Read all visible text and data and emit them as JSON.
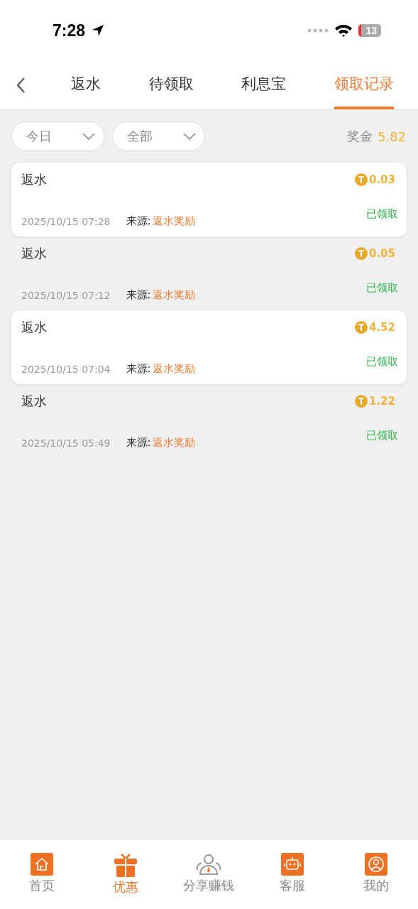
{
  "status_bar": {
    "time": "7:28",
    "battery": "13"
  },
  "tabs": [
    {
      "label": "返水",
      "selected": false
    },
    {
      "label": "待领取",
      "selected": false
    },
    {
      "label": "利息宝",
      "selected": false
    },
    {
      "label": "领取记录",
      "selected": true
    }
  ],
  "filters": [
    {
      "value": "今日"
    },
    {
      "value": "全部"
    }
  ],
  "bonus": {
    "label": "奖金",
    "value": "5.82"
  },
  "records": [
    {
      "title": "返水",
      "amount": "0.03",
      "time": "2025/10/15 07:28",
      "source_label": "来源:",
      "source": "返水奖励",
      "status": "已领取",
      "highlighted": true
    },
    {
      "title": "返水",
      "amount": "0.05",
      "time": "2025/10/15 07:12",
      "source_label": "来源:",
      "source": "返水奖励",
      "status": "已领取",
      "highlighted": false
    },
    {
      "title": "返水",
      "amount": "4.52",
      "time": "2025/10/15 07:04",
      "source_label": "来源:",
      "source": "返水奖励",
      "status": "已领取",
      "highlighted": true
    },
    {
      "title": "返水",
      "amount": "1.22",
      "time": "2025/10/15 05:49",
      "source_label": "来源:",
      "source": "返水奖励",
      "status": "已领取",
      "highlighted": false
    }
  ],
  "nav": [
    {
      "label": "首页",
      "kind": "home",
      "selected": false
    },
    {
      "label": "优惠",
      "kind": "gift",
      "selected": true
    },
    {
      "label": "分享赚钱",
      "kind": "share",
      "selected": false
    },
    {
      "label": "客服",
      "kind": "robot",
      "selected": false
    },
    {
      "label": "我的",
      "kind": "user",
      "selected": false
    }
  ]
}
